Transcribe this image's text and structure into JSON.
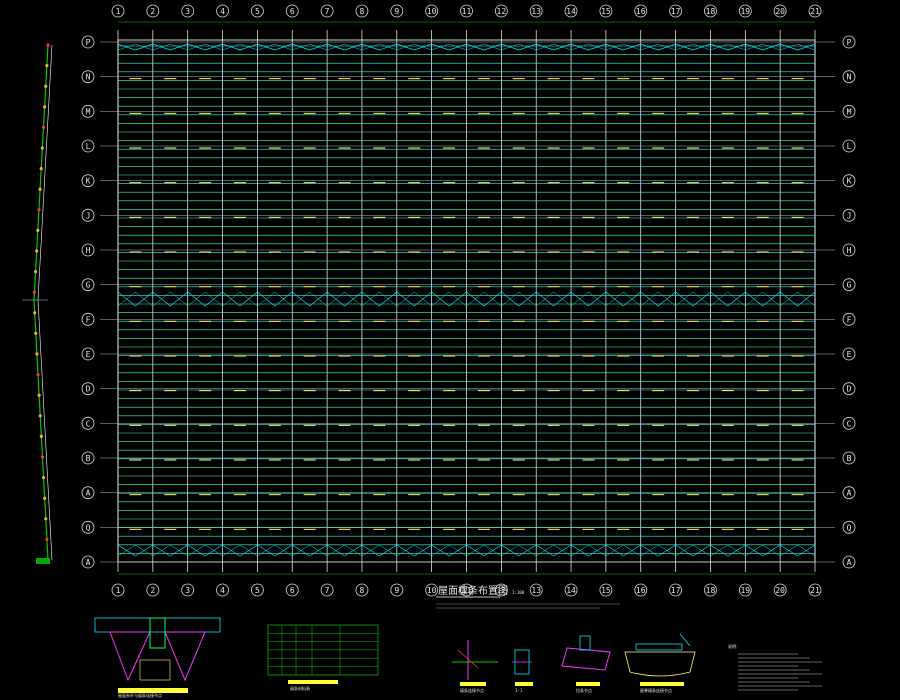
{
  "drawing": {
    "title": "屋面檩条布置图",
    "scale": "1:100",
    "colors": {
      "background": "#000000",
      "purlin": "#ffff66",
      "rafter": "#ffffff",
      "grid": "#33ffcc",
      "brace": "#00e5ff",
      "dimension": "#00cc00",
      "detail": "#ff33ff",
      "highlight": "#ff3333"
    },
    "column_axes": [
      "1",
      "2",
      "3",
      "4",
      "5",
      "6",
      "7",
      "8",
      "9",
      "10",
      "11",
      "12",
      "13",
      "14",
      "15",
      "16",
      "17",
      "18",
      "19",
      "20",
      "21"
    ],
    "row_axes": [
      "P",
      "N",
      "M",
      "L",
      "K",
      "J",
      "H",
      "G",
      "F",
      "E",
      "D",
      "C",
      "B",
      "A",
      "Q",
      "A"
    ],
    "details": {
      "detail_1_title": "屋面系杆与檩条连接节点",
      "table_title": "檩条材料表",
      "section_1_title": "檩条连接节点",
      "section_2_title": "1-1",
      "section_3_title": "拉条节点",
      "section_4_title": "屋脊檩条连接节点",
      "notes_title": "说明："
    }
  }
}
